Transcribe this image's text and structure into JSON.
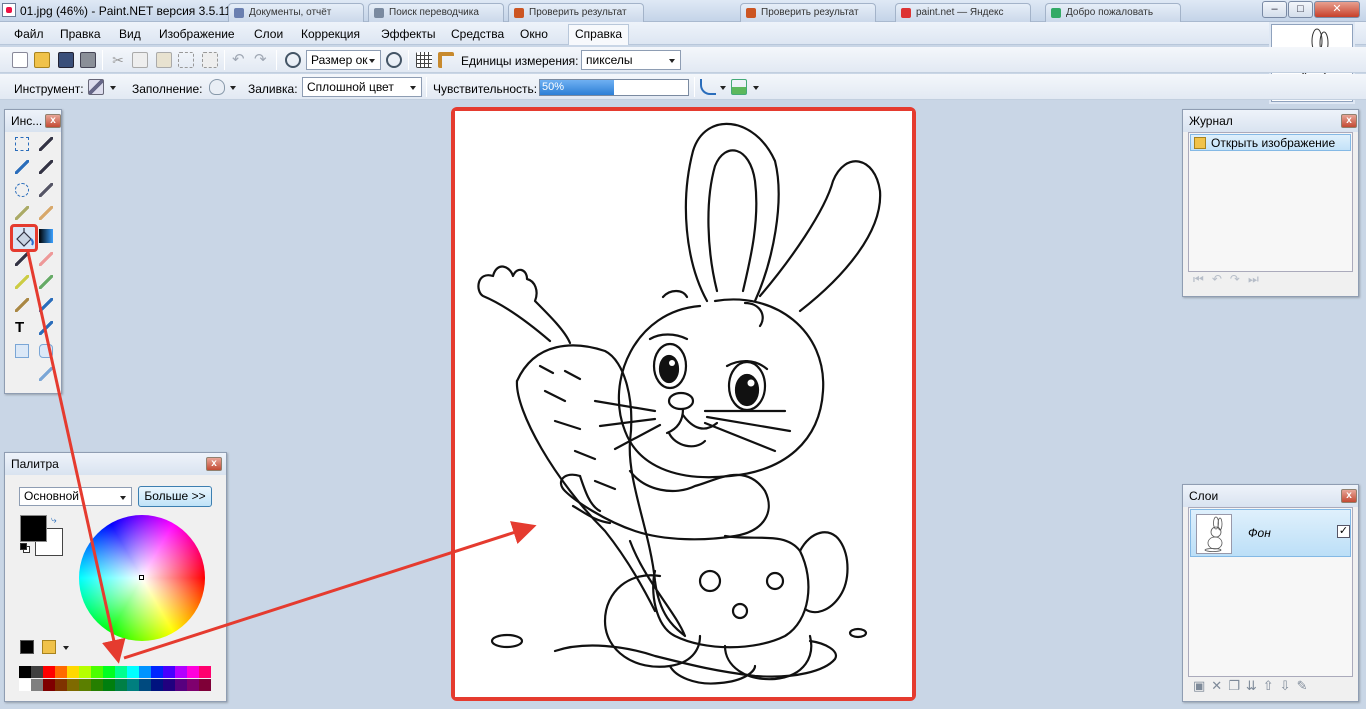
{
  "window": {
    "title": "01.jpg (46%) - Paint.NET версия 3.5.11",
    "tabs": [
      "Документы, отчёт",
      "Поиск переводчика",
      "Проверить результат",
      "Проверить результат",
      "paint.net — Яндекс",
      "Добро пожаловать"
    ],
    "controls": {
      "minimize": "–",
      "maximize": "□",
      "close": "✕"
    }
  },
  "menu": [
    "Файл",
    "Правка",
    "Вид",
    "Изображение",
    "Слои",
    "Коррекция",
    "Эффекты",
    "Средства",
    "Окно",
    "Справка"
  ],
  "toolbar1": {
    "zoom_select": "Размер ок",
    "units_label": "Единицы измерения:",
    "units_value": "пикселы"
  },
  "toolbar2": {
    "tool_label": "Инструмент:",
    "fill_mode_label": "Заполнение:",
    "fill_label": "Заливка:",
    "fill_value": "Сплошной цвет",
    "tolerance_label": "Чувствительность:",
    "tolerance_value": "50%",
    "tolerance_fraction": 0.5
  },
  "tools_panel": {
    "title": "Инс...",
    "close": "x",
    "tools": [
      "rectangle-select-icon",
      "move-selection-icon",
      "lasso-select-icon",
      "move-selected-icon",
      "ellipse-select-icon",
      "zoom-icon",
      "magic-wand-icon",
      "pan-icon",
      "paint-bucket-icon",
      "gradient-icon",
      "paintbrush-icon",
      "eraser-icon",
      "pencil-icon",
      "color-picker-icon",
      "clone-stamp-icon",
      "recolor-icon",
      "text-icon",
      "line-curve-icon",
      "rectangle-icon",
      "rounded-rectangle-icon",
      "ellipse-icon",
      "freeform-shape-icon"
    ]
  },
  "palette_panel": {
    "title": "Палитра",
    "close": "x",
    "mode_select": "Основной",
    "more_button": "Больше >>",
    "primary_color": "#000000",
    "secondary_color": "#ffffff",
    "swatches_row1": [
      "#000000",
      "#404040",
      "#ff0000",
      "#ff6a00",
      "#ffd800",
      "#b6ff00",
      "#4cff00",
      "#00ff21",
      "#00ff90",
      "#00ffff",
      "#0094ff",
      "#0026ff",
      "#4800ff",
      "#b200ff",
      "#ff00dc",
      "#ff006e"
    ],
    "swatches_row2": [
      "#ffffff",
      "#808080",
      "#7f0000",
      "#7f3300",
      "#7f6a00",
      "#5b7f00",
      "#267f00",
      "#007f0e",
      "#007f46",
      "#007f7f",
      "#004a7f",
      "#00137f",
      "#21007f",
      "#57007f",
      "#7f006e",
      "#7f0037"
    ]
  },
  "history_panel": {
    "title": "Журнал",
    "close": "x",
    "items": [
      "Открыть изображение"
    ]
  },
  "layers_panel": {
    "title": "Слои",
    "close": "x",
    "layers": [
      {
        "name": "Фон",
        "visible": true
      }
    ],
    "checkmark": "✓"
  },
  "colors": {
    "highlight": "#e53b2f",
    "workspace": "#c9d6e6"
  }
}
